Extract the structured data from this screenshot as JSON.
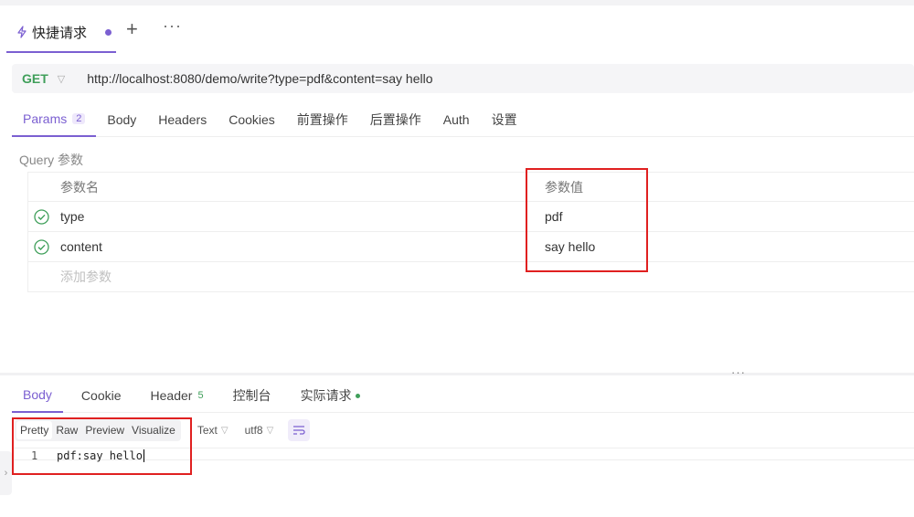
{
  "tab": {
    "title": "快捷请求"
  },
  "request": {
    "method": "GET",
    "url": "http://localhost:8080/demo/write?type=pdf&content=say hello"
  },
  "request_tabs": [
    {
      "label": "Params",
      "badge": "2"
    },
    {
      "label": "Body"
    },
    {
      "label": "Headers"
    },
    {
      "label": "Cookies"
    },
    {
      "label": "前置操作"
    },
    {
      "label": "后置操作"
    },
    {
      "label": "Auth"
    },
    {
      "label": "设置"
    }
  ],
  "query": {
    "section_label": "Query 参数",
    "col_name": "参数名",
    "col_value": "参数值",
    "rows": [
      {
        "name": "type",
        "value": "pdf"
      },
      {
        "name": "content",
        "value": "say hello"
      }
    ],
    "add_placeholder": "添加参数"
  },
  "response_tabs": [
    {
      "label": "Body"
    },
    {
      "label": "Cookie"
    },
    {
      "label": "Header",
      "count": "5"
    },
    {
      "label": "控制台"
    },
    {
      "label": "实际请求"
    }
  ],
  "view_modes": [
    "Pretty",
    "Raw",
    "Preview",
    "Visualize"
  ],
  "format": "Text",
  "encoding": "utf8",
  "response_body": {
    "line": "1",
    "text": "pdf:say hello"
  },
  "colors": {
    "accent": "#7b5fd1",
    "get": "#3f9f5a",
    "highlight": "#e02020"
  }
}
